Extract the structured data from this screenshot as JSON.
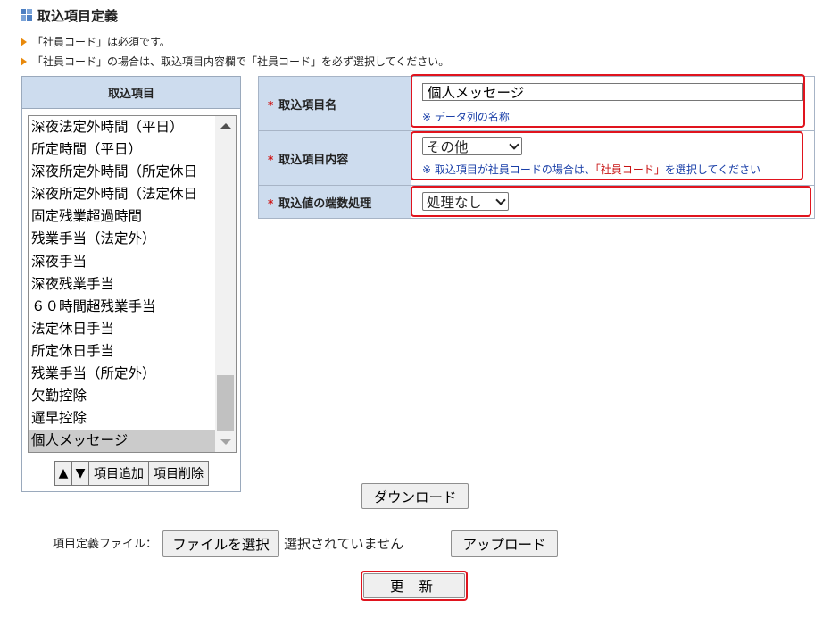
{
  "page": {
    "title": "取込項目定義",
    "notes": [
      "「社員コード」は必須です。",
      "「社員コード」の場合は、取込項目内容欄で「社員コード」を必ず選択してください。"
    ]
  },
  "list_panel": {
    "header": "取込項目",
    "items": [
      "深夜法定外時間（平日）",
      "所定時間（平日）",
      "深夜所定外時間（所定休日",
      "深夜所定外時間（法定休日",
      "固定残業超過時間",
      "残業手当（法定外）",
      "深夜手当",
      "深夜残業手当",
      "６０時間超残業手当",
      "法定休日手当",
      "所定休日手当",
      "残業手当（所定外）",
      "欠勤控除",
      "遅早控除",
      "個人メッセージ"
    ],
    "selected_item": "個人メッセージ",
    "buttons": {
      "up": "▲",
      "down": "▼",
      "add": "項目追加",
      "delete": "項目削除"
    }
  },
  "form": {
    "required_mark": "*",
    "name_row": {
      "label": "取込項目名",
      "value": "個人メッセージ",
      "hint": "※ データ列の名称"
    },
    "content_row": {
      "label": "取込項目内容",
      "selected": "その他",
      "hint_prefix": "※ 取込項目が社員コードの場合は、",
      "hint_red": "「社員コード」",
      "hint_suffix": "を選択してください"
    },
    "rounding_row": {
      "label": "取込値の端数処理",
      "selected": "処理なし"
    }
  },
  "actions": {
    "download": "ダウンロード",
    "file_label": "項目定義ファイル：",
    "choose_file": "ファイルを選択",
    "file_status": "選択されていません",
    "upload": "アップロード",
    "update": "更 新"
  },
  "colors": {
    "header_bg": "#cddcee",
    "highlight_border": "#e0141e",
    "hint_blue": "#1a3fa8",
    "bullet_orange": "#e8890c"
  }
}
